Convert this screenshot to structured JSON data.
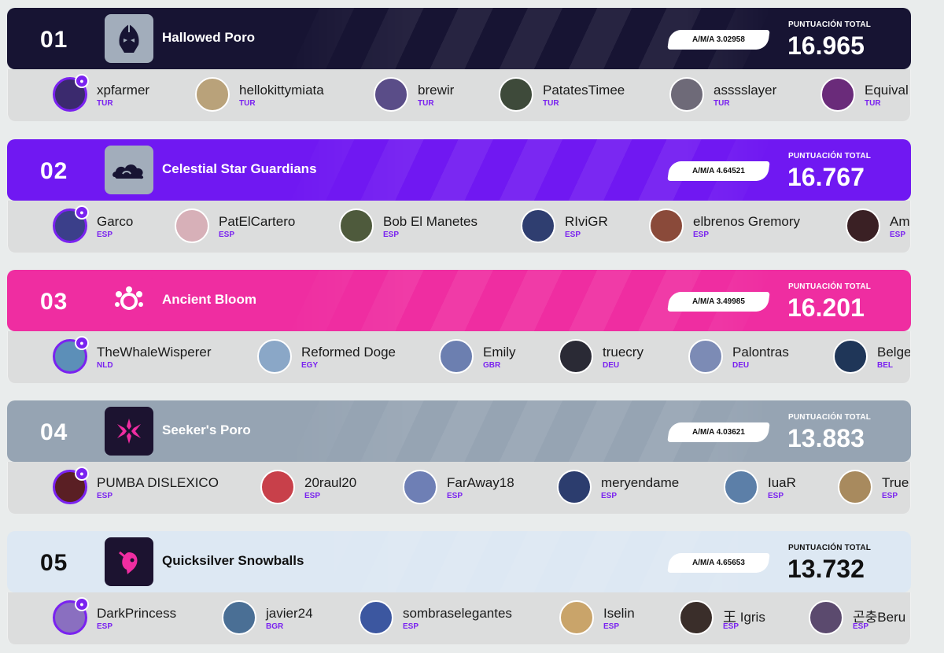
{
  "score_label": "PUNTUACIÓN TOTAL",
  "teams": [
    {
      "rank": "01",
      "name": "Hallowed Poro",
      "ama": "A/M/A 3.02958",
      "score": "16.965",
      "colors": {
        "bg": "#171433",
        "text": "#ffffff",
        "emblem_bg": "#a2adbb",
        "emblem_fg": "#171433"
      },
      "emblem_icon": "hallowed-poro-icon",
      "members": [
        {
          "name": "xpfarmer",
          "country": "TUR",
          "avatar": "#3b2a6e",
          "captain": true
        },
        {
          "name": "hellokittymiata",
          "country": "TUR",
          "avatar": "#b9a27a"
        },
        {
          "name": "brewir",
          "country": "TUR",
          "avatar": "#5a4d88"
        },
        {
          "name": "PatatesTimee",
          "country": "TUR",
          "avatar": "#3e4a3a"
        },
        {
          "name": "asssslayer",
          "country": "TUR",
          "avatar": "#6e6a78"
        },
        {
          "name": "Equival",
          "country": "TUR",
          "avatar": "#6a2b7a"
        }
      ]
    },
    {
      "rank": "02",
      "name": "Celestial Star Guardians",
      "ama": "A/M/A 4.64521",
      "score": "16.767",
      "colors": {
        "bg": "#7018f2",
        "text": "#ffffff",
        "emblem_bg": "#a2adbb",
        "emblem_fg": "#171433"
      },
      "emblem_icon": "cloud-icon",
      "members": [
        {
          "name": "Garco",
          "country": "ESP",
          "avatar": "#3b3f8a",
          "captain": true
        },
        {
          "name": "PatElCartero",
          "country": "ESP",
          "avatar": "#d7b0b8"
        },
        {
          "name": "Bob El Manetes",
          "country": "ESP",
          "avatar": "#4e5a3c"
        },
        {
          "name": "RIviGR",
          "country": "ESP",
          "avatar": "#2f3e70"
        },
        {
          "name": "elbrenos Gremory",
          "country": "ESP",
          "avatar": "#8a4a3a"
        },
        {
          "name": "Am",
          "country": "ESP",
          "avatar": "#3a2024"
        }
      ]
    },
    {
      "rank": "03",
      "name": "Ancient Bloom",
      "ama": "A/M/A 3.49985",
      "score": "16.201",
      "colors": {
        "bg": "#ef2da1",
        "text": "#ffffff",
        "emblem_bg": "#ef2da1",
        "emblem_fg": "#ffffff"
      },
      "emblem_icon": "bloom-icon",
      "members": [
        {
          "name": "TheWhaleWisperer",
          "country": "NLD",
          "avatar": "#5c8fb8",
          "captain": true
        },
        {
          "name": "Reformed Doge",
          "country": "EGY",
          "avatar": "#8aa7c7"
        },
        {
          "name": "Emily",
          "country": "GBR",
          "avatar": "#6c7fb0"
        },
        {
          "name": "truecry",
          "country": "DEU",
          "avatar": "#2a2a35"
        },
        {
          "name": "Palontras",
          "country": "DEU",
          "avatar": "#7c8bb5"
        },
        {
          "name": "Belge",
          "country": "BEL",
          "avatar": "#1f3658"
        }
      ]
    },
    {
      "rank": "04",
      "name": "Seeker's Poro",
      "ama": "A/M/A 4.03621",
      "score": "13.883",
      "colors": {
        "bg": "#96a4b3",
        "text": "#ffffff",
        "emblem_bg": "#1c1330",
        "emblem_fg": "#ef2da1"
      },
      "emblem_icon": "flower-icon",
      "members": [
        {
          "name": "PUMBA DISLEXICO",
          "country": "ESP",
          "avatar": "#5a1f24",
          "captain": true
        },
        {
          "name": "20raul20",
          "country": "ESP",
          "avatar": "#c8404a"
        },
        {
          "name": "FarAway18",
          "country": "ESP",
          "avatar": "#6e7fb5"
        },
        {
          "name": "meryendame",
          "country": "ESP",
          "avatar": "#2c3d6e"
        },
        {
          "name": "IuaR",
          "country": "ESP",
          "avatar": "#5c7fa8"
        },
        {
          "name": "True",
          "country": "ESP",
          "avatar": "#a88a5e"
        }
      ]
    },
    {
      "rank": "05",
      "name": "Quicksilver Snowballs",
      "ama": "A/M/A 4.65653",
      "score": "13.732",
      "colors": {
        "bg": "#dde8f3",
        "text": "#111111",
        "emblem_bg": "#1c1330",
        "emblem_fg": "#ef2da1"
      },
      "emblem_icon": "quicksilver-icon",
      "members": [
        {
          "name": "DarkPrincess",
          "country": "ESP",
          "avatar": "#8a6fc0",
          "captain": true
        },
        {
          "name": "javier24",
          "country": "BGR",
          "avatar": "#4a6f95"
        },
        {
          "name": "sombraselegantes",
          "country": "ESP",
          "avatar": "#3c57a0"
        },
        {
          "name": "Iselin",
          "country": "ESP",
          "avatar": "#c9a46a"
        },
        {
          "name": "王 Igris",
          "country": "ESP",
          "avatar": "#3a2e2a"
        },
        {
          "name": "곤충Beru",
          "country": "ESP",
          "avatar": "#5b4a6e"
        }
      ]
    }
  ]
}
